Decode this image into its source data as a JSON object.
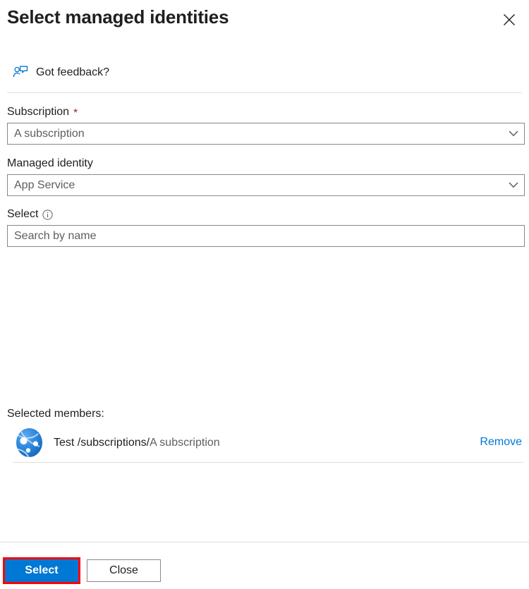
{
  "dialog": {
    "title": "Select managed identities",
    "close_icon": "close-icon"
  },
  "feedback": {
    "label": "Got feedback?",
    "icon": "feedback-person-icon"
  },
  "form": {
    "subscription": {
      "label": "Subscription",
      "required_marker": "*",
      "value": "A subscription",
      "chevron_icon": "chevron-down-icon"
    },
    "managed_identity": {
      "label": "Managed identity",
      "value": "App Service",
      "chevron_icon": "chevron-down-icon"
    },
    "select": {
      "label": "Select",
      "info_icon": "info-icon",
      "search_placeholder": "Search by name",
      "search_value": ""
    }
  },
  "selected_members": {
    "heading": "Selected members:",
    "items": [
      {
        "avatar_icon": "app-service-icon",
        "name": "Test",
        "path": "/subscriptions/",
        "subscription": "A subscription",
        "remove_label": "Remove"
      }
    ]
  },
  "footer": {
    "select_label": "Select",
    "close_label": "Close"
  },
  "colors": {
    "accent": "#0078d4",
    "required": "#a4262c",
    "highlight_border": "#ff0000",
    "border": "#8a8886",
    "divider": "#e1dfdd",
    "text": "#201f1e",
    "muted_text": "#605e5c"
  }
}
